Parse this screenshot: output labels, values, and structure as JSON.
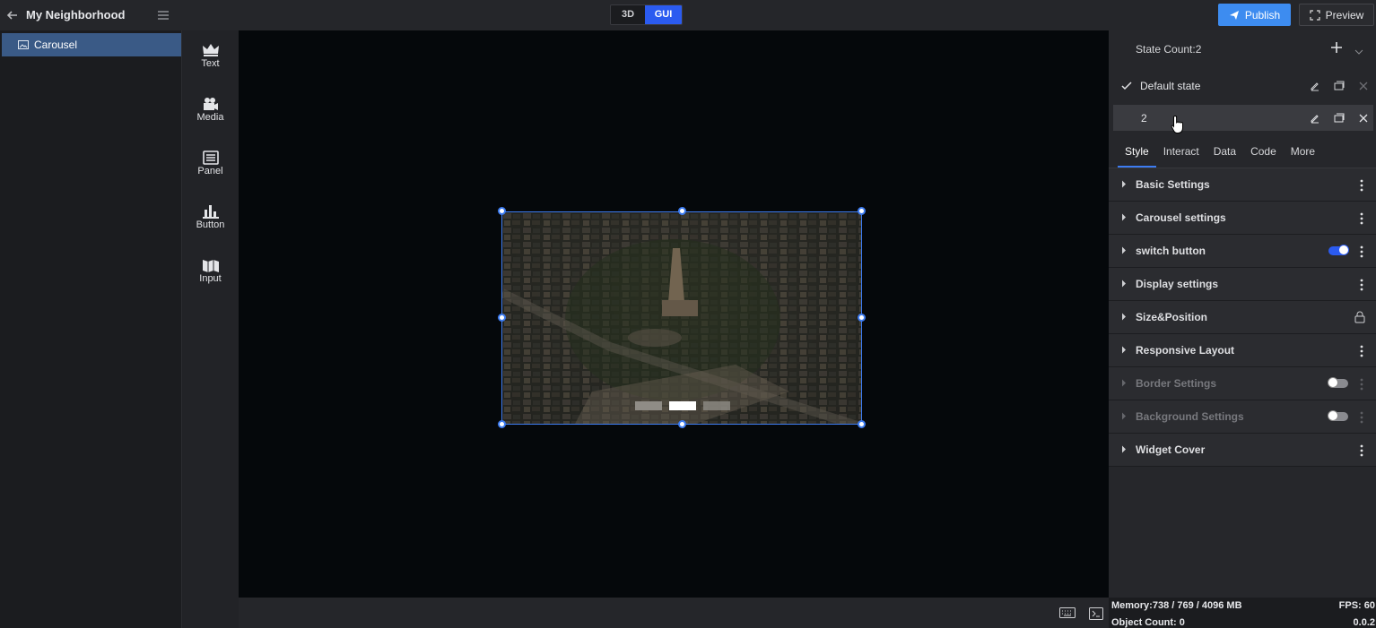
{
  "topbar": {
    "project_title": "My Neighborhood",
    "mode_3d": "3D",
    "mode_gui": "GUI",
    "publish_label": "Publish",
    "preview_label": "Preview"
  },
  "layers": {
    "items": [
      {
        "label": "Carousel",
        "icon": "image-icon"
      }
    ]
  },
  "widgets": [
    {
      "label": "Text",
      "icon": "crown-icon"
    },
    {
      "label": "Media",
      "icon": "media-icon"
    },
    {
      "label": "Panel",
      "icon": "panel-icon"
    },
    {
      "label": "Button",
      "icon": "bar-chart-icon"
    },
    {
      "label": "Input",
      "icon": "map-icon"
    }
  ],
  "canvas": {
    "carousel_dots": 3,
    "active_dot": 2
  },
  "states": {
    "count_label": "State Count:2",
    "items": [
      {
        "name": "Default state",
        "checked": true
      },
      {
        "name": "2",
        "checked": false,
        "selected": true
      }
    ]
  },
  "tabs": [
    "Style",
    "Interact",
    "Data",
    "Code",
    "More"
  ],
  "active_tab": "Style",
  "sections": [
    {
      "label": "Basic Settings",
      "control": "kebab"
    },
    {
      "label": "Carousel settings",
      "control": "kebab"
    },
    {
      "label": "switch button",
      "control": "toggle-on"
    },
    {
      "label": "Display settings",
      "control": "kebab"
    },
    {
      "label": "Size&Position",
      "control": "lock"
    },
    {
      "label": "Responsive Layout",
      "control": "kebab"
    },
    {
      "label": "Border Settings",
      "control": "toggle-off",
      "disabled": true
    },
    {
      "label": "Background Settings",
      "control": "toggle-off",
      "disabled": true
    },
    {
      "label": "Widget Cover",
      "control": "kebab"
    }
  ],
  "status": {
    "memory": "Memory:738 / 769 / 4096 MB",
    "fps": "FPS: 60",
    "object_count": "Object Count: 0",
    "version": "0.0.2"
  },
  "colors": {
    "accent": "#3d7cf2",
    "publish": "#3d8cf0",
    "selected_layer": "#3a5a86"
  }
}
